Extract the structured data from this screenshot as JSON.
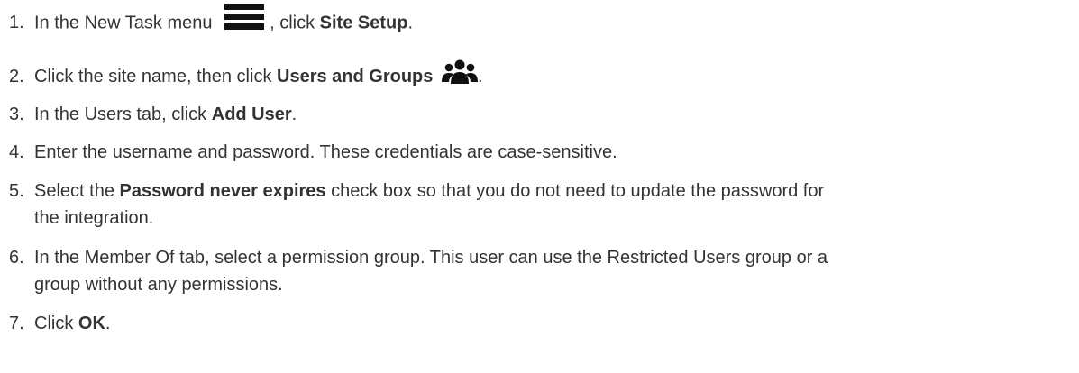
{
  "steps": [
    {
      "number": "1.",
      "pre": "In the New Task menu",
      "icon": "hamburger-menu-icon",
      "mid": ", click ",
      "bold": "Site Setup",
      "post": "."
    },
    {
      "number": "2.",
      "pre": "Click the site name, then click ",
      "bold": "Users and Groups",
      "icon": "users-group-icon",
      "post": "."
    },
    {
      "number": "3.",
      "pre": "In the Users tab, click ",
      "bold": "Add User",
      "post": "."
    },
    {
      "number": "4.",
      "text": "Enter the username and password. These credentials are case-sensitive."
    },
    {
      "number": "5.",
      "pre": "Select the ",
      "bold": "Password never expires",
      "post_line1": " check box so that you do not need to update the password for",
      "post_line2": "the integration."
    },
    {
      "number": "6.",
      "line1": "In the Member Of tab, select a permission group. This user can use the Restricted Users group or a",
      "line2": "group without any permissions."
    },
    {
      "number": "7.",
      "pre": "Click ",
      "bold": "OK",
      "post": "."
    }
  ],
  "colors": {
    "text": "#333333",
    "icon": "#111111"
  }
}
